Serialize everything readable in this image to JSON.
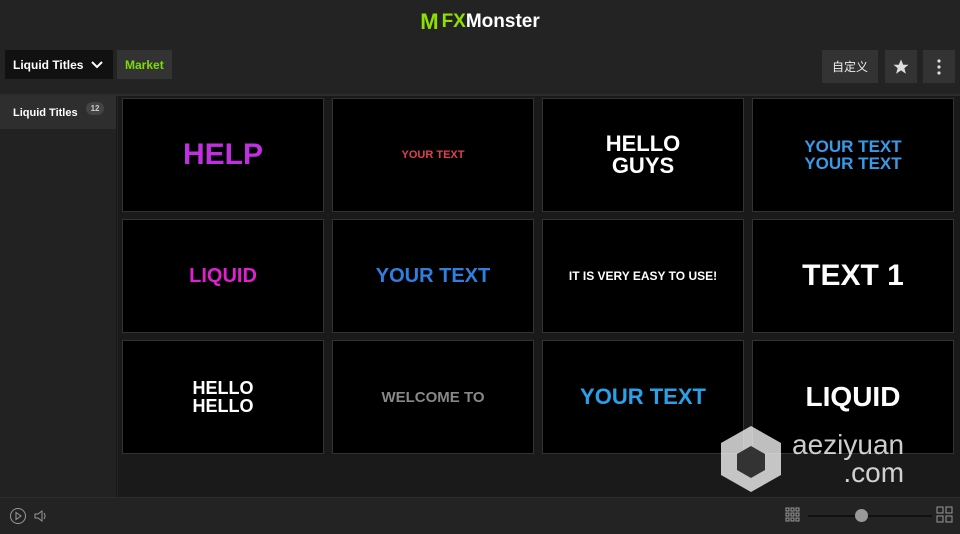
{
  "header": {
    "logo_mark": "M",
    "logo_fx": "FX",
    "logo_rest": "Monster",
    "brand_color": "#8ee000"
  },
  "toolbar": {
    "dropdown_label": "Liquid Titles",
    "market_label": "Market",
    "customize_label": "自定义",
    "star_icon": "star-icon",
    "more_icon": "more-vertical-icon"
  },
  "sidebar": {
    "items": [
      {
        "label": "Liquid Titles",
        "count": "12"
      }
    ]
  },
  "tiles": [
    {
      "text": "HELP",
      "color": "#c030e0"
    },
    {
      "text": "YOUR TEXT",
      "color": "#e04050"
    },
    {
      "text": "HELLO GUYS",
      "color": "#ffffff"
    },
    {
      "text": "YOUR TEXT YOUR TEXT",
      "color": "#3a9ae8"
    },
    {
      "text": "LIQUID",
      "color": "#e020d0"
    },
    {
      "text": "YOUR TEXT",
      "color": "#2f7fe0"
    },
    {
      "text": "IT IS VERY EASY TO USE!",
      "color": "#ffffff"
    },
    {
      "text": "TEXT 1",
      "color": "#ffffff"
    },
    {
      "text": "HELLO HELLO",
      "color": "#ffffff"
    },
    {
      "text": "WELCOME TO",
      "color": "#888888"
    },
    {
      "text": "YOUR TEXT",
      "color": "#2aa0e8"
    },
    {
      "text": "LIQUID",
      "color": "#ffffff"
    }
  ],
  "footer": {
    "play_icon": "play-icon",
    "volume_icon": "volume-icon",
    "small_grid_icon": "grid-small-icon",
    "large_grid_icon": "grid-large-icon",
    "zoom_level": 0.43
  },
  "watermark": {
    "text": "aeziyuan",
    "suffix": ".com"
  }
}
